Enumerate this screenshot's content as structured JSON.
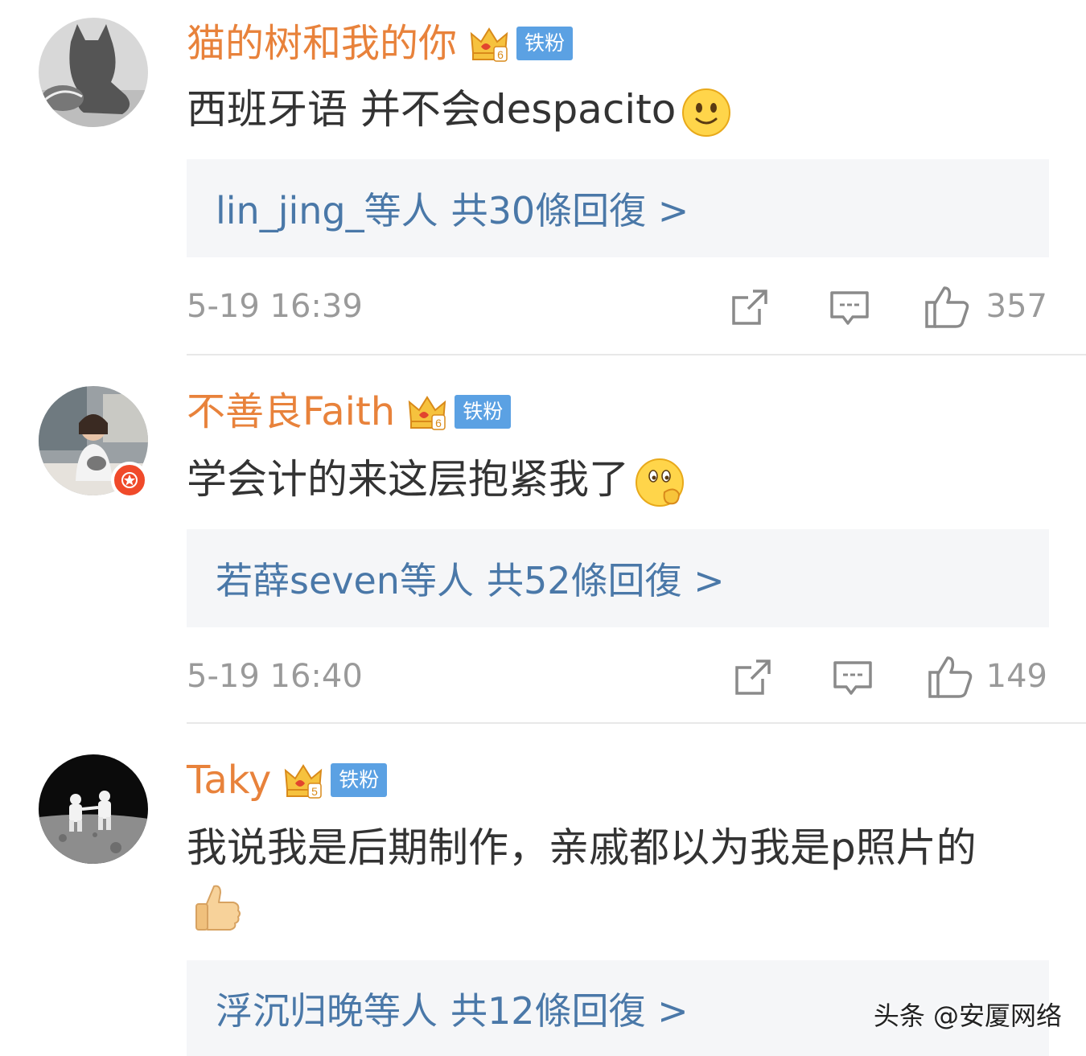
{
  "comments": [
    {
      "username": "猫的树和我的你",
      "fan_badge": "铁粉",
      "text": "西班牙语 并不会despacito",
      "reply_summary": {
        "names": "lin_jing_等人",
        "count_text": "共30條回復 >"
      },
      "timestamp": "5-19 16:39",
      "likes": "357",
      "emoji": "smile-emoji"
    },
    {
      "username": "不善良Faith",
      "fan_badge": "铁粉",
      "text": "学会计的来这层抱紧我了",
      "reply_summary": {
        "names": "若薛seven等人",
        "count_text": "共52條回復 >"
      },
      "timestamp": "5-19 16:40",
      "likes": "149",
      "emoji": "thinking-emoji"
    },
    {
      "username": "Taky",
      "fan_badge": "铁粉",
      "text": "我说我是后期制作，亲戚都以为我是p照片的",
      "reply_summary": {
        "names": "浮沉归晚等人",
        "count_text": "共12條回復 >"
      },
      "emoji": "thumbs-up-emoji"
    }
  ],
  "watermark": "头条 @安厦网络",
  "colors": {
    "username": "#e8823b",
    "reply_link": "#4a78a8",
    "fan_badge": "#5ba1e3",
    "meta_text": "#9a9a9a",
    "reply_bg": "#f5f6f8"
  },
  "icons": {
    "crown": "vip-crown-icon",
    "share": "share-icon",
    "comment": "comment-icon",
    "like": "like-icon",
    "verified": "verified-star-icon"
  }
}
